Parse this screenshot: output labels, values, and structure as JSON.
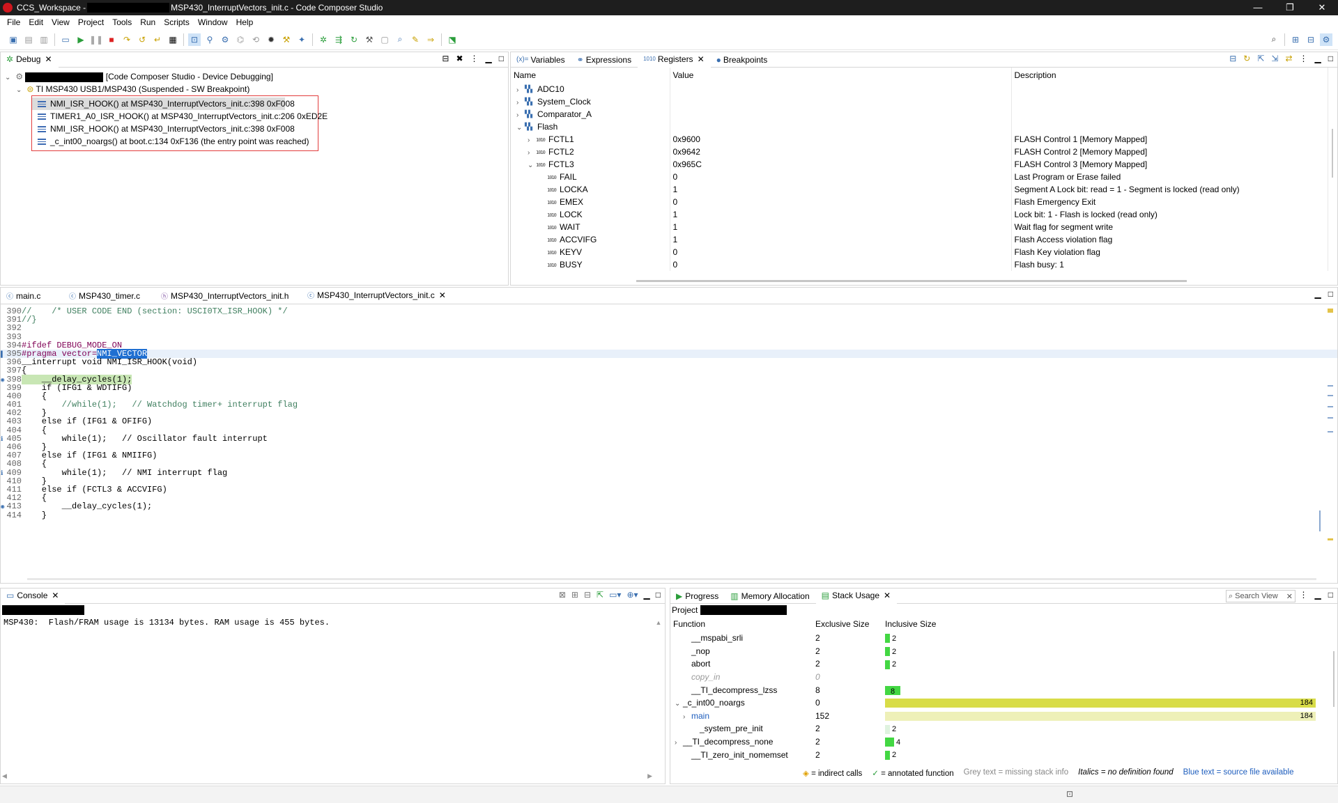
{
  "window": {
    "title_prefix": "CCS_Workspace -",
    "title_suffix": "MSP430_InterruptVectors_init.c - Code Composer Studio",
    "min": "—",
    "max": "❐",
    "close": "✕"
  },
  "menu": [
    "File",
    "Edit",
    "View",
    "Project",
    "Tools",
    "Run",
    "Scripts",
    "Window",
    "Help"
  ],
  "debug": {
    "tab": "Debug",
    "root_label": "[Code Composer Studio - Device Debugging]",
    "target_label": "TI MSP430 USB1/MSP430 (Suspended - SW Breakpoint)",
    "frames": [
      "NMI_ISR_HOOK() at MSP430_InterruptVectors_init.c:398 0xF008",
      "TIMER1_A0_ISR_HOOK() at MSP430_InterruptVectors_init.c:206 0xED2E",
      "NMI_ISR_HOOK() at MSP430_InterruptVectors_init.c:398 0xF008",
      "_c_int00_noargs() at boot.c:134 0xF136  (the entry point was reached)"
    ]
  },
  "regview": {
    "tabs": [
      "Variables",
      "Expressions",
      "Registers",
      "Breakpoints"
    ],
    "columns": [
      "Name",
      "Value",
      "Description"
    ],
    "rows": [
      {
        "name": "ADC10",
        "value": "",
        "desc": "",
        "chev": "›"
      },
      {
        "name": "System_Clock",
        "value": "",
        "desc": "",
        "chev": "›"
      },
      {
        "name": "Comparator_A",
        "value": "",
        "desc": "",
        "chev": "›"
      },
      {
        "name": "Flash",
        "value": "",
        "desc": "",
        "chev": "⌄"
      },
      {
        "name": "FCTL1",
        "value": "0x9600",
        "desc": "FLASH Control 1 [Memory Mapped]",
        "chev": "›"
      },
      {
        "name": "FCTL2",
        "value": "0x9642",
        "desc": "FLASH Control 2 [Memory Mapped]",
        "chev": "›"
      },
      {
        "name": "FCTL3",
        "value": "0x965C",
        "desc": "FLASH Control 3 [Memory Mapped]",
        "chev": "⌄"
      },
      {
        "name": "FAIL",
        "value": "0",
        "desc": "Last Program or Erase failed",
        "chev": ""
      },
      {
        "name": "LOCKA",
        "value": "1",
        "desc": "Segment A Lock bit: read = 1 - Segment is locked (read only)",
        "chev": ""
      },
      {
        "name": "EMEX",
        "value": "0",
        "desc": "Flash Emergency Exit",
        "chev": ""
      },
      {
        "name": "LOCK",
        "value": "1",
        "desc": "Lock bit: 1 - Flash is locked (read only)",
        "chev": ""
      },
      {
        "name": "WAIT",
        "value": "1",
        "desc": "Wait flag for segment write",
        "chev": ""
      },
      {
        "name": "ACCVIFG",
        "value": "1",
        "desc": "Flash Access violation flag",
        "chev": ""
      },
      {
        "name": "KEYV",
        "value": "0",
        "desc": "Flash Key violation flag",
        "chev": ""
      },
      {
        "name": "BUSY",
        "value": "0",
        "desc": "Flash busy: 1",
        "chev": ""
      }
    ]
  },
  "editor": {
    "tabs": [
      "main.c",
      "MSP430_timer.c",
      "MSP430_InterruptVectors_init.h",
      "MSP430_InterruptVectors_init.c"
    ],
    "lines": [
      {
        "n": "390",
        "t": "//    /* USER CODE END (section: USCI0TX_ISR_HOOK) */"
      },
      {
        "n": "391",
        "t": "//}"
      },
      {
        "n": "392",
        "t": ""
      },
      {
        "n": "393",
        "t": ""
      },
      {
        "n": "394",
        "t": "#ifdef DEBUG_MODE_ON"
      },
      {
        "n": "395",
        "t": "#pragma vector=NMI_VECTOR"
      },
      {
        "n": "396",
        "t": "__interrupt void NMI_ISR_HOOK(void)"
      },
      {
        "n": "397",
        "t": "{"
      },
      {
        "n": "398",
        "t": "    __delay_cycles(1);"
      },
      {
        "n": "399",
        "t": "    if (IFG1 & WDTIFG)"
      },
      {
        "n": "400",
        "t": "    {"
      },
      {
        "n": "401",
        "t": "        //while(1);   // Watchdog timer+ interrupt flag"
      },
      {
        "n": "402",
        "t": "    }"
      },
      {
        "n": "403",
        "t": "    else if (IFG1 & OFIFG)"
      },
      {
        "n": "404",
        "t": "    {"
      },
      {
        "n": "405",
        "t": "        while(1);   // Oscillator fault interrupt"
      },
      {
        "n": "406",
        "t": "    }"
      },
      {
        "n": "407",
        "t": "    else if (IFG1 & NMIIFG)"
      },
      {
        "n": "408",
        "t": "    {"
      },
      {
        "n": "409",
        "t": "        while(1);   // NMI interrupt flag"
      },
      {
        "n": "410",
        "t": "    }"
      },
      {
        "n": "411",
        "t": "    else if (FCTL3 & ACCVIFG)"
      },
      {
        "n": "412",
        "t": "    {"
      },
      {
        "n": "413",
        "t": "        __delay_cycles(1);"
      },
      {
        "n": "414",
        "t": "    }"
      }
    ]
  },
  "console": {
    "tab": "Console",
    "output": "MSP430:  Flash/FRAM usage is 13134 bytes. RAM usage is 455 bytes."
  },
  "stack": {
    "tabs": [
      "Progress",
      "Memory Allocation",
      "Stack Usage"
    ],
    "search_placeholder": "Search View",
    "project_label": "Project",
    "columns": [
      "Function",
      "Exclusive Size",
      "Inclusive Size"
    ],
    "rows": [
      {
        "fn": "__mspabi_srli",
        "ex": "2",
        "inc": "2",
        "incv": 2,
        "style": "normal",
        "color": "#43d743",
        "indent": 1,
        "chev": ""
      },
      {
        "fn": "_nop",
        "ex": "2",
        "inc": "2",
        "incv": 2,
        "style": "normal",
        "color": "#43d743",
        "indent": 1,
        "chev": ""
      },
      {
        "fn": "abort",
        "ex": "2",
        "inc": "2",
        "incv": 2,
        "style": "normal",
        "color": "#43d743",
        "indent": 1,
        "chev": ""
      },
      {
        "fn": "copy_in",
        "ex": "0",
        "inc": "",
        "incv": 0,
        "style": "grey",
        "color": "#43d743",
        "indent": 1,
        "chev": ""
      },
      {
        "fn": "__TI_decompress_lzss",
        "ex": "8",
        "inc": "8",
        "incv": 8,
        "style": "normal",
        "color": "#43d743",
        "indent": 1,
        "chev": ""
      },
      {
        "fn": "_c_int00_noargs",
        "ex": "0",
        "inc": "184",
        "incv": 184,
        "style": "normal",
        "color": "#d8dc48",
        "indent": 0,
        "chev": "⌄"
      },
      {
        "fn": "main",
        "ex": "152",
        "inc": "184",
        "incv": 184,
        "style": "blue",
        "color": "#eef0b8",
        "indent": 1,
        "chev": "›"
      },
      {
        "fn": "_system_pre_init",
        "ex": "2",
        "inc": "2",
        "incv": 2,
        "style": "normal",
        "color": "#dff3df",
        "indent": 2,
        "chev": ""
      },
      {
        "fn": "__TI_decompress_none",
        "ex": "2",
        "inc": "4",
        "incv": 4,
        "style": "normal",
        "color": "#43d743",
        "indent": 0,
        "chev": "›"
      },
      {
        "fn": "__TI_zero_init_nomemset",
        "ex": "2",
        "inc": "2",
        "incv": 2,
        "style": "normal",
        "color": "#43d743",
        "indent": 1,
        "chev": ""
      }
    ],
    "max_value": 184,
    "legend": {
      "indirect": "= indirect calls",
      "annotated": "= annotated function",
      "grey": "Grey text = missing stack info",
      "italics": "Italics = no definition found",
      "blue": "Blue text = source file available"
    }
  }
}
